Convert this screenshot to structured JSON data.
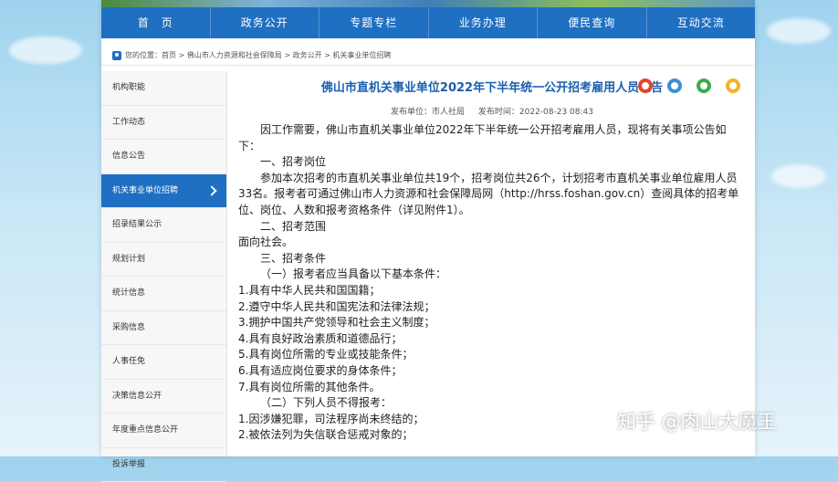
{
  "nav": {
    "items": [
      "首　页",
      "政务公开",
      "专题专栏",
      "业务办理",
      "便民查询",
      "互动交流"
    ]
  },
  "breadcrumb": {
    "prefix": "您的位置：",
    "path": [
      "首页",
      "佛山市人力资源和社会保障局",
      "政务公开",
      "机关事业单位招聘"
    ],
    "separator": " > "
  },
  "sidebar": {
    "items": [
      {
        "label": "机构职能",
        "active": false
      },
      {
        "label": "工作动态",
        "active": false
      },
      {
        "label": "信息公告",
        "active": false
      },
      {
        "label": "机关事业单位招聘",
        "active": true
      },
      {
        "label": "招录结果公示",
        "active": false
      },
      {
        "label": "规划计划",
        "active": false
      },
      {
        "label": "统计信息",
        "active": false
      },
      {
        "label": "采购信息",
        "active": false
      },
      {
        "label": "人事任免",
        "active": false
      },
      {
        "label": "决策信息公开",
        "active": false
      },
      {
        "label": "年度重点信息公开",
        "active": false
      },
      {
        "label": "投诉举报",
        "active": false
      }
    ]
  },
  "article": {
    "title": "佛山市直机关事业单位2022年下半年统一公开招考雇用人员公告",
    "publisher": "发布单位：市人社局",
    "date": "发布时间：2022-08-23 08:43",
    "paragraphs": [
      {
        "style": "indent",
        "text": "因工作需要，佛山市直机关事业单位2022年下半年统一公开招考雇用人员，现将有关事项公告如下："
      },
      {
        "style": "indent",
        "text": "一、招考岗位"
      },
      {
        "style": "indent",
        "text": "参加本次招考的市直机关事业单位共19个，招考岗位共26个，计划招考市直机关事业单位雇用人员33名。报考者可通过佛山市人力资源和社会保障局网（http://hrss.foshan.gov.cn）查阅具体的招考单位、岗位、人数和报考资格条件（详见附件1）。"
      },
      {
        "style": "indent",
        "text": "二、招考范围"
      },
      {
        "style": "plain",
        "text": "面向社会。"
      },
      {
        "style": "indent",
        "text": "三、招考条件"
      },
      {
        "style": "indent",
        "text": "（一）报考者应当具备以下基本条件："
      },
      {
        "style": "plain",
        "text": "1.具有中华人民共和国国籍；"
      },
      {
        "style": "plain",
        "text": "2.遵守中华人民共和国宪法和法律法规；"
      },
      {
        "style": "plain",
        "text": "3.拥护中国共产党领导和社会主义制度；"
      },
      {
        "style": "plain",
        "text": "4.具有良好政治素质和道德品行；"
      },
      {
        "style": "plain",
        "text": "5.具有岗位所需的专业或技能条件；"
      },
      {
        "style": "plain",
        "text": "6.具有适应岗位要求的身体条件；"
      },
      {
        "style": "plain",
        "text": "7.具有岗位所需的其他条件。"
      },
      {
        "style": "indent",
        "text": "（二）下列人员不得报考："
      },
      {
        "style": "plain",
        "text": "1.因涉嫌犯罪，司法程序尚未终结的；"
      },
      {
        "style": "plain",
        "text": "2.被依法列为失信联合惩戒对象的；"
      }
    ]
  },
  "share": {
    "icons": [
      "weibo-icon",
      "qq-icon",
      "wechat-icon",
      "qzone-icon"
    ]
  },
  "watermark": "知乎 @肉山大魔王",
  "colors": {
    "nav_bg": "#1f6fc2",
    "title": "#1a5fb0",
    "sidebar_active": "#1f6fc2"
  }
}
